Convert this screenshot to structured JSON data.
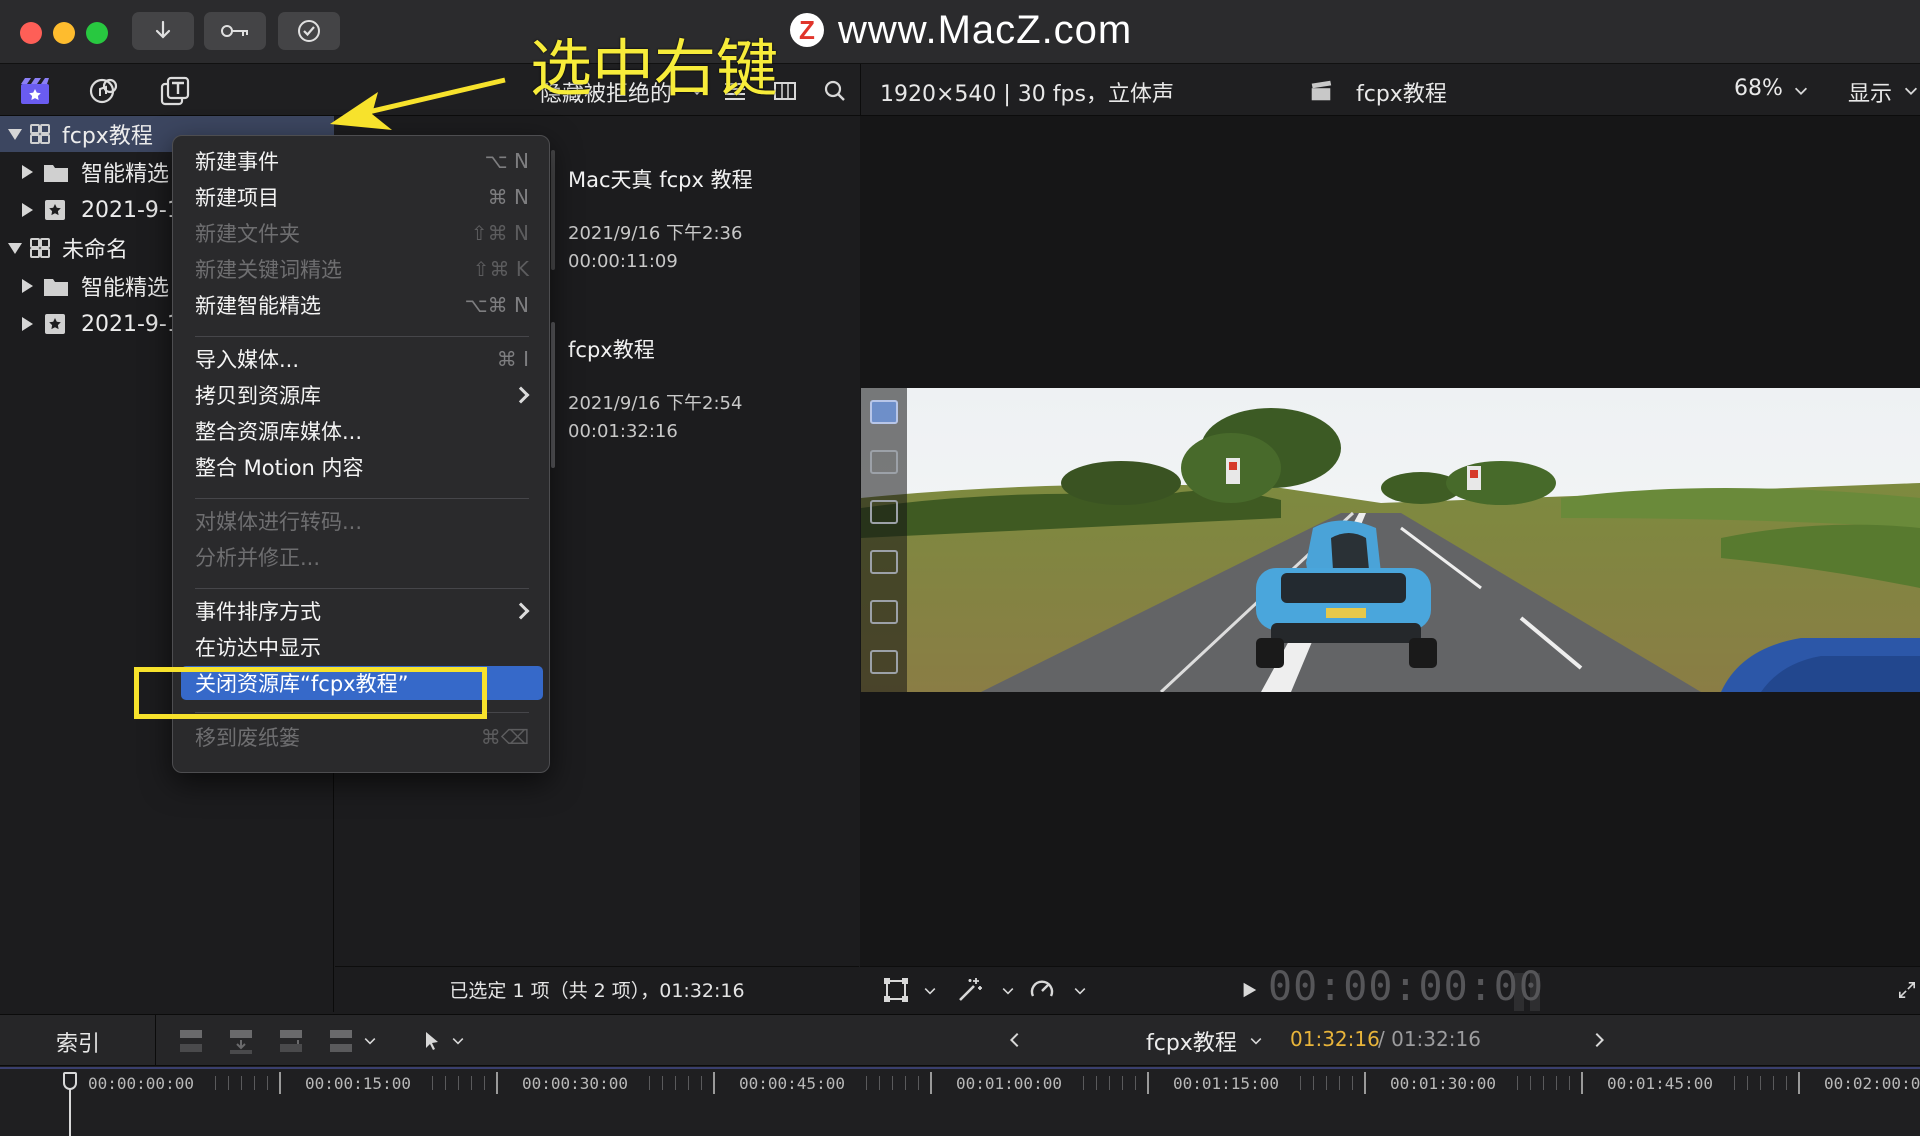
{
  "watermark": {
    "logo": "Z",
    "text": "www.MacZ.com"
  },
  "titlebar": {
    "buttons": [
      "download-icon",
      "key-icon",
      "checkmark-icon"
    ]
  },
  "annotation": {
    "callout": "选中右键"
  },
  "browser_toolbar": {
    "filter": "隐藏被拒绝的"
  },
  "viewer_toolbar": {
    "format": "1920×540 | 30 fps，立体声",
    "project": "fcpx教程",
    "zoom": "68%",
    "display": "显示"
  },
  "sidebar": {
    "items": [
      {
        "label": "fcpx教程",
        "expanded": true,
        "selected": true
      },
      {
        "label": "智能精选"
      },
      {
        "label": "2021-9-1"
      },
      {
        "label": "未命名",
        "expanded": true
      },
      {
        "label": "智能精选"
      },
      {
        "label": "2021-9-1"
      }
    ]
  },
  "browser": {
    "clips": [
      {
        "title": "Mac天真 fcpx 教程",
        "date": "2021/9/16 下午2:36",
        "duration": "00:00:11:09"
      },
      {
        "title": "fcpx教程",
        "date": "2021/9/16 下午2:54",
        "duration": "00:01:32:16"
      }
    ],
    "footer": "已选定 1 项（共 2 项），01:32:16"
  },
  "context_menu": {
    "items": [
      {
        "label": "新建事件",
        "shortcut": "⌥ N",
        "state": "enabled"
      },
      {
        "label": "新建项目",
        "shortcut": "⌘ N",
        "state": "enabled"
      },
      {
        "label": "新建文件夹",
        "shortcut": "⇧⌘ N",
        "state": "disabled"
      },
      {
        "label": "新建关键词精选",
        "shortcut": "⇧⌘ K",
        "state": "disabled"
      },
      {
        "label": "新建智能精选",
        "shortcut": "⌥⌘ N",
        "state": "enabled"
      },
      {
        "label": "导入媒体...",
        "shortcut": "⌘ I",
        "state": "enabled"
      },
      {
        "label": "拷贝到资源库",
        "shortcut": "",
        "state": "enabled"
      },
      {
        "label": "整合资源库媒体...",
        "shortcut": "",
        "state": "enabled"
      },
      {
        "label": "整合 Motion 内容",
        "shortcut": "",
        "state": "enabled"
      },
      {
        "label": "对媒体进行转码...",
        "shortcut": "",
        "state": "disabled"
      },
      {
        "label": "分析并修正...",
        "shortcut": "",
        "state": "disabled"
      },
      {
        "label": "事件排序方式",
        "shortcut": "",
        "state": "enabled"
      },
      {
        "label": "在访达中显示",
        "shortcut": "",
        "state": "enabled"
      },
      {
        "label": "关闭资源库“fcpx教程”",
        "shortcut": "",
        "state": "highlighted"
      },
      {
        "label": "移到废纸篓",
        "shortcut": "⌘⌫",
        "state": "disabled"
      }
    ]
  },
  "viewer": {
    "timecode": "00:00:00:00"
  },
  "timeline": {
    "index_label": "索引",
    "project": "fcpx教程",
    "current": "01:32:16",
    "total": "/ 01:32:16",
    "ruler": [
      "00:00:00:00",
      "00:00:15:00",
      "00:00:30:00",
      "00:00:45:00",
      "00:01:00:00",
      "00:01:15:00",
      "00:01:30:00",
      "00:01:45:00",
      "00:02:00:0"
    ]
  },
  "colors": {
    "accent": "#3669c9",
    "annotation": "#f7e22c",
    "timecode_current": "#e8b43a"
  }
}
